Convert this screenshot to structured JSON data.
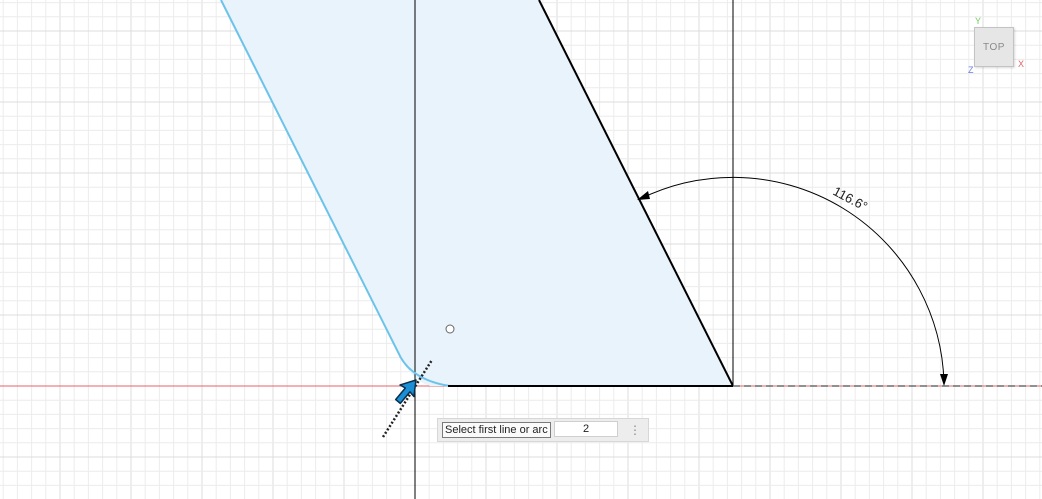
{
  "sketch": {
    "angle_dimension": "116.6°",
    "colors": {
      "grid_minor": "#ececec",
      "grid_major": "#dcdcdc",
      "x_axis": "#e06464",
      "profile_fill": "#e9f3fb",
      "fillet_preview": "#6cc3ea",
      "sketch_line": "#000000",
      "cursor_fill": "#1a8fd6"
    }
  },
  "viewcube": {
    "face_label": "TOP",
    "axis_x": "X",
    "axis_y": "Y",
    "axis_z": "Z"
  },
  "prompt": {
    "message": "Select first line or arc",
    "value": "2",
    "more_icon": "vertical-ellipsis-icon"
  }
}
